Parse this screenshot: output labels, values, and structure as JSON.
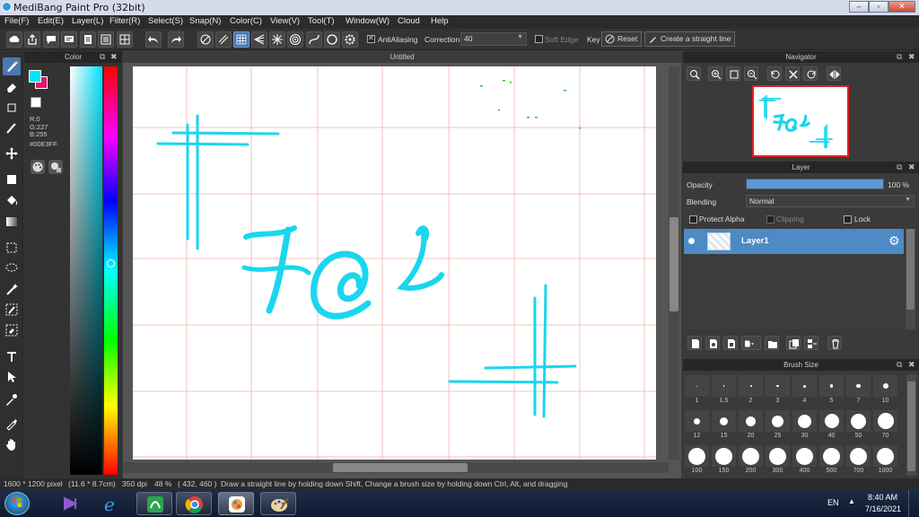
{
  "window": {
    "title": "MediBang Paint Pro (32bit)"
  },
  "menu": [
    "File(F)",
    "Edit(E)",
    "Layer(L)",
    "Filter(R)",
    "Select(S)",
    "Snap(N)",
    "Color(C)",
    "View(V)",
    "Tool(T)",
    "Window(W)",
    "Cloud",
    "Help"
  ],
  "toolbar": {
    "antialiasing_label": "AntiAliasing",
    "correction_label": "Correction",
    "correction_value": "40",
    "soft_edge_label": "Soft Edge",
    "key_label": "Key",
    "reset_label": "Reset",
    "straight_line_label": "Create a straight line"
  },
  "color_panel": {
    "title": "Color",
    "primary_color": "#00E3FF",
    "secondary_color": "#E8146C",
    "r": "R:0",
    "g": "G:227",
    "b": "B:255",
    "hex": "#00E3FF"
  },
  "document": {
    "tab_title": "Untitled",
    "canvas_text": "F@1"
  },
  "navigator": {
    "title": "Navigator"
  },
  "layer_panel": {
    "title": "Layer",
    "opacity_label": "Opacity",
    "opacity_value": "100 %",
    "opacity_fraction": 1.0,
    "blending_label": "Blending",
    "blending_value": "Normal",
    "protect_alpha_label": "Protect Alpha",
    "clipping_label": "Clipping",
    "lock_label": "Lock",
    "layers": [
      {
        "name": "Layer1"
      }
    ]
  },
  "brush_size_panel": {
    "title": "Brush Size",
    "sizes": [
      "1",
      "1.5",
      "2",
      "3",
      "4",
      "5",
      "7",
      "10",
      "12",
      "15",
      "20",
      "25",
      "30",
      "40",
      "50",
      "70",
      "100",
      "150",
      "200",
      "300",
      "400",
      "500",
      "700",
      "1000"
    ]
  },
  "status": {
    "image_size": "1600 * 1200 pixel",
    "physical_size": "(11.6 * 8.7cm)",
    "dpi": "350 dpi",
    "zoom": "48 %",
    "cursor": "( 432, 460 )",
    "hint": "Draw a straight line by holding down Shift, Change a brush size by holding down Ctrl, Alt, and dragging"
  },
  "taskbar": {
    "language": "EN",
    "time": "8:40 AM",
    "date": "7/16/2021"
  },
  "colors": {
    "accent": "#4a78b0",
    "stroke": "#1ad6ee"
  }
}
